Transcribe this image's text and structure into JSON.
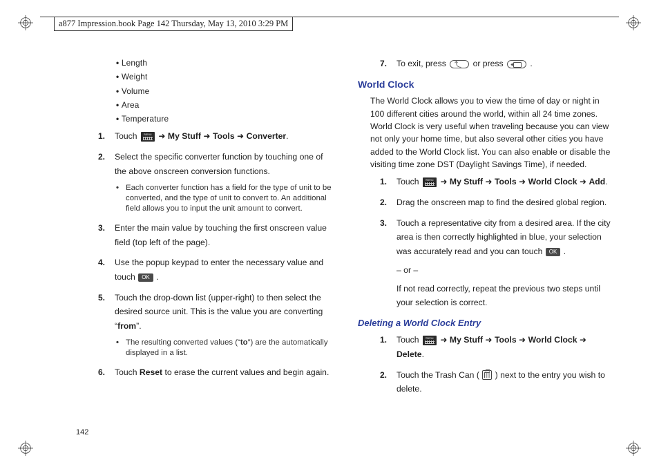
{
  "header": "a877 Impression.book  Page 142  Thursday, May 13, 2010  3:29 PM",
  "page_number": "142",
  "left": {
    "bullets": [
      "Length",
      "Weight",
      "Volume",
      "Area",
      "Temperature"
    ],
    "steps": [
      {
        "n": "1.",
        "pre": "Touch  ",
        "path_parts": [
          "My Stuff",
          "Tools",
          "Converter"
        ],
        "post": "."
      },
      {
        "n": "2.",
        "text": "Select the specific converter function by touching one of the above onscreen conversion functions.",
        "sub": [
          "Each converter function has a field for the type of unit to be converted, and the type of unit to convert to. An additional field allows you to input the unit amount to convert."
        ]
      },
      {
        "n": "3.",
        "text": "Enter the main value by touching the first onscreen value field (top left of the page)."
      },
      {
        "n": "4.",
        "pre": "Use the popup keypad to enter the necessary value and touch ",
        "ok": true,
        "post": " ."
      },
      {
        "n": "5.",
        "pre": "Touch the drop-down list (upper-right) to then select the desired source unit. This is the value you are converting “",
        "bword": "from",
        "post2": "”.",
        "sub": [
          "The resulting converted values (“to”) are the automatically displayed in a list."
        ],
        "boldto": "to"
      },
      {
        "n": "6.",
        "pre": "Touch ",
        "bword": "Reset",
        "post": " to erase the current values and begin again."
      }
    ]
  },
  "right": {
    "step7": {
      "n": "7.",
      "pre": "To exit, press ",
      "mid": " or press  ",
      "post": " ."
    },
    "h1": "World Clock",
    "intro": "The World Clock allows you to view the time of day or night in 100 different cities around the world, within all 24 time zones. World Clock is very useful when traveling because you can view not only your home time, but also several other cities you have added to the World Clock list. You can also enable or disable the visiting time zone DST (Daylight Savings Time), if needed.",
    "wc_steps": [
      {
        "n": "1.",
        "pre": "Touch  ",
        "path_parts": [
          "My Stuff",
          "Tools",
          "World Clock",
          "Add"
        ],
        "post": "."
      },
      {
        "n": "2.",
        "text": "Drag the onscreen map to find the desired global region."
      },
      {
        "n": "3.",
        "pre": "Touch a representative city from a desired area. If the city area is then correctly highlighted in blue, your selection was accurately read and you can touch ",
        "ok": true,
        "post": " .",
        "or": "– or –",
        "tail": "If not read correctly, repeat the previous two steps until your selection is correct."
      }
    ],
    "h2": "Deleting a World Clock Entry",
    "del_steps": [
      {
        "n": "1.",
        "pre": "Touch  ",
        "path_parts": [
          "My Stuff",
          "Tools",
          "World Clock",
          "Delete"
        ],
        "post": "."
      },
      {
        "n": "2.",
        "pre": "Touch the Trash Can ( ",
        "trash": true,
        "post": " ) next to the entry you wish to delete."
      }
    ]
  },
  "arrow": " ➜ "
}
